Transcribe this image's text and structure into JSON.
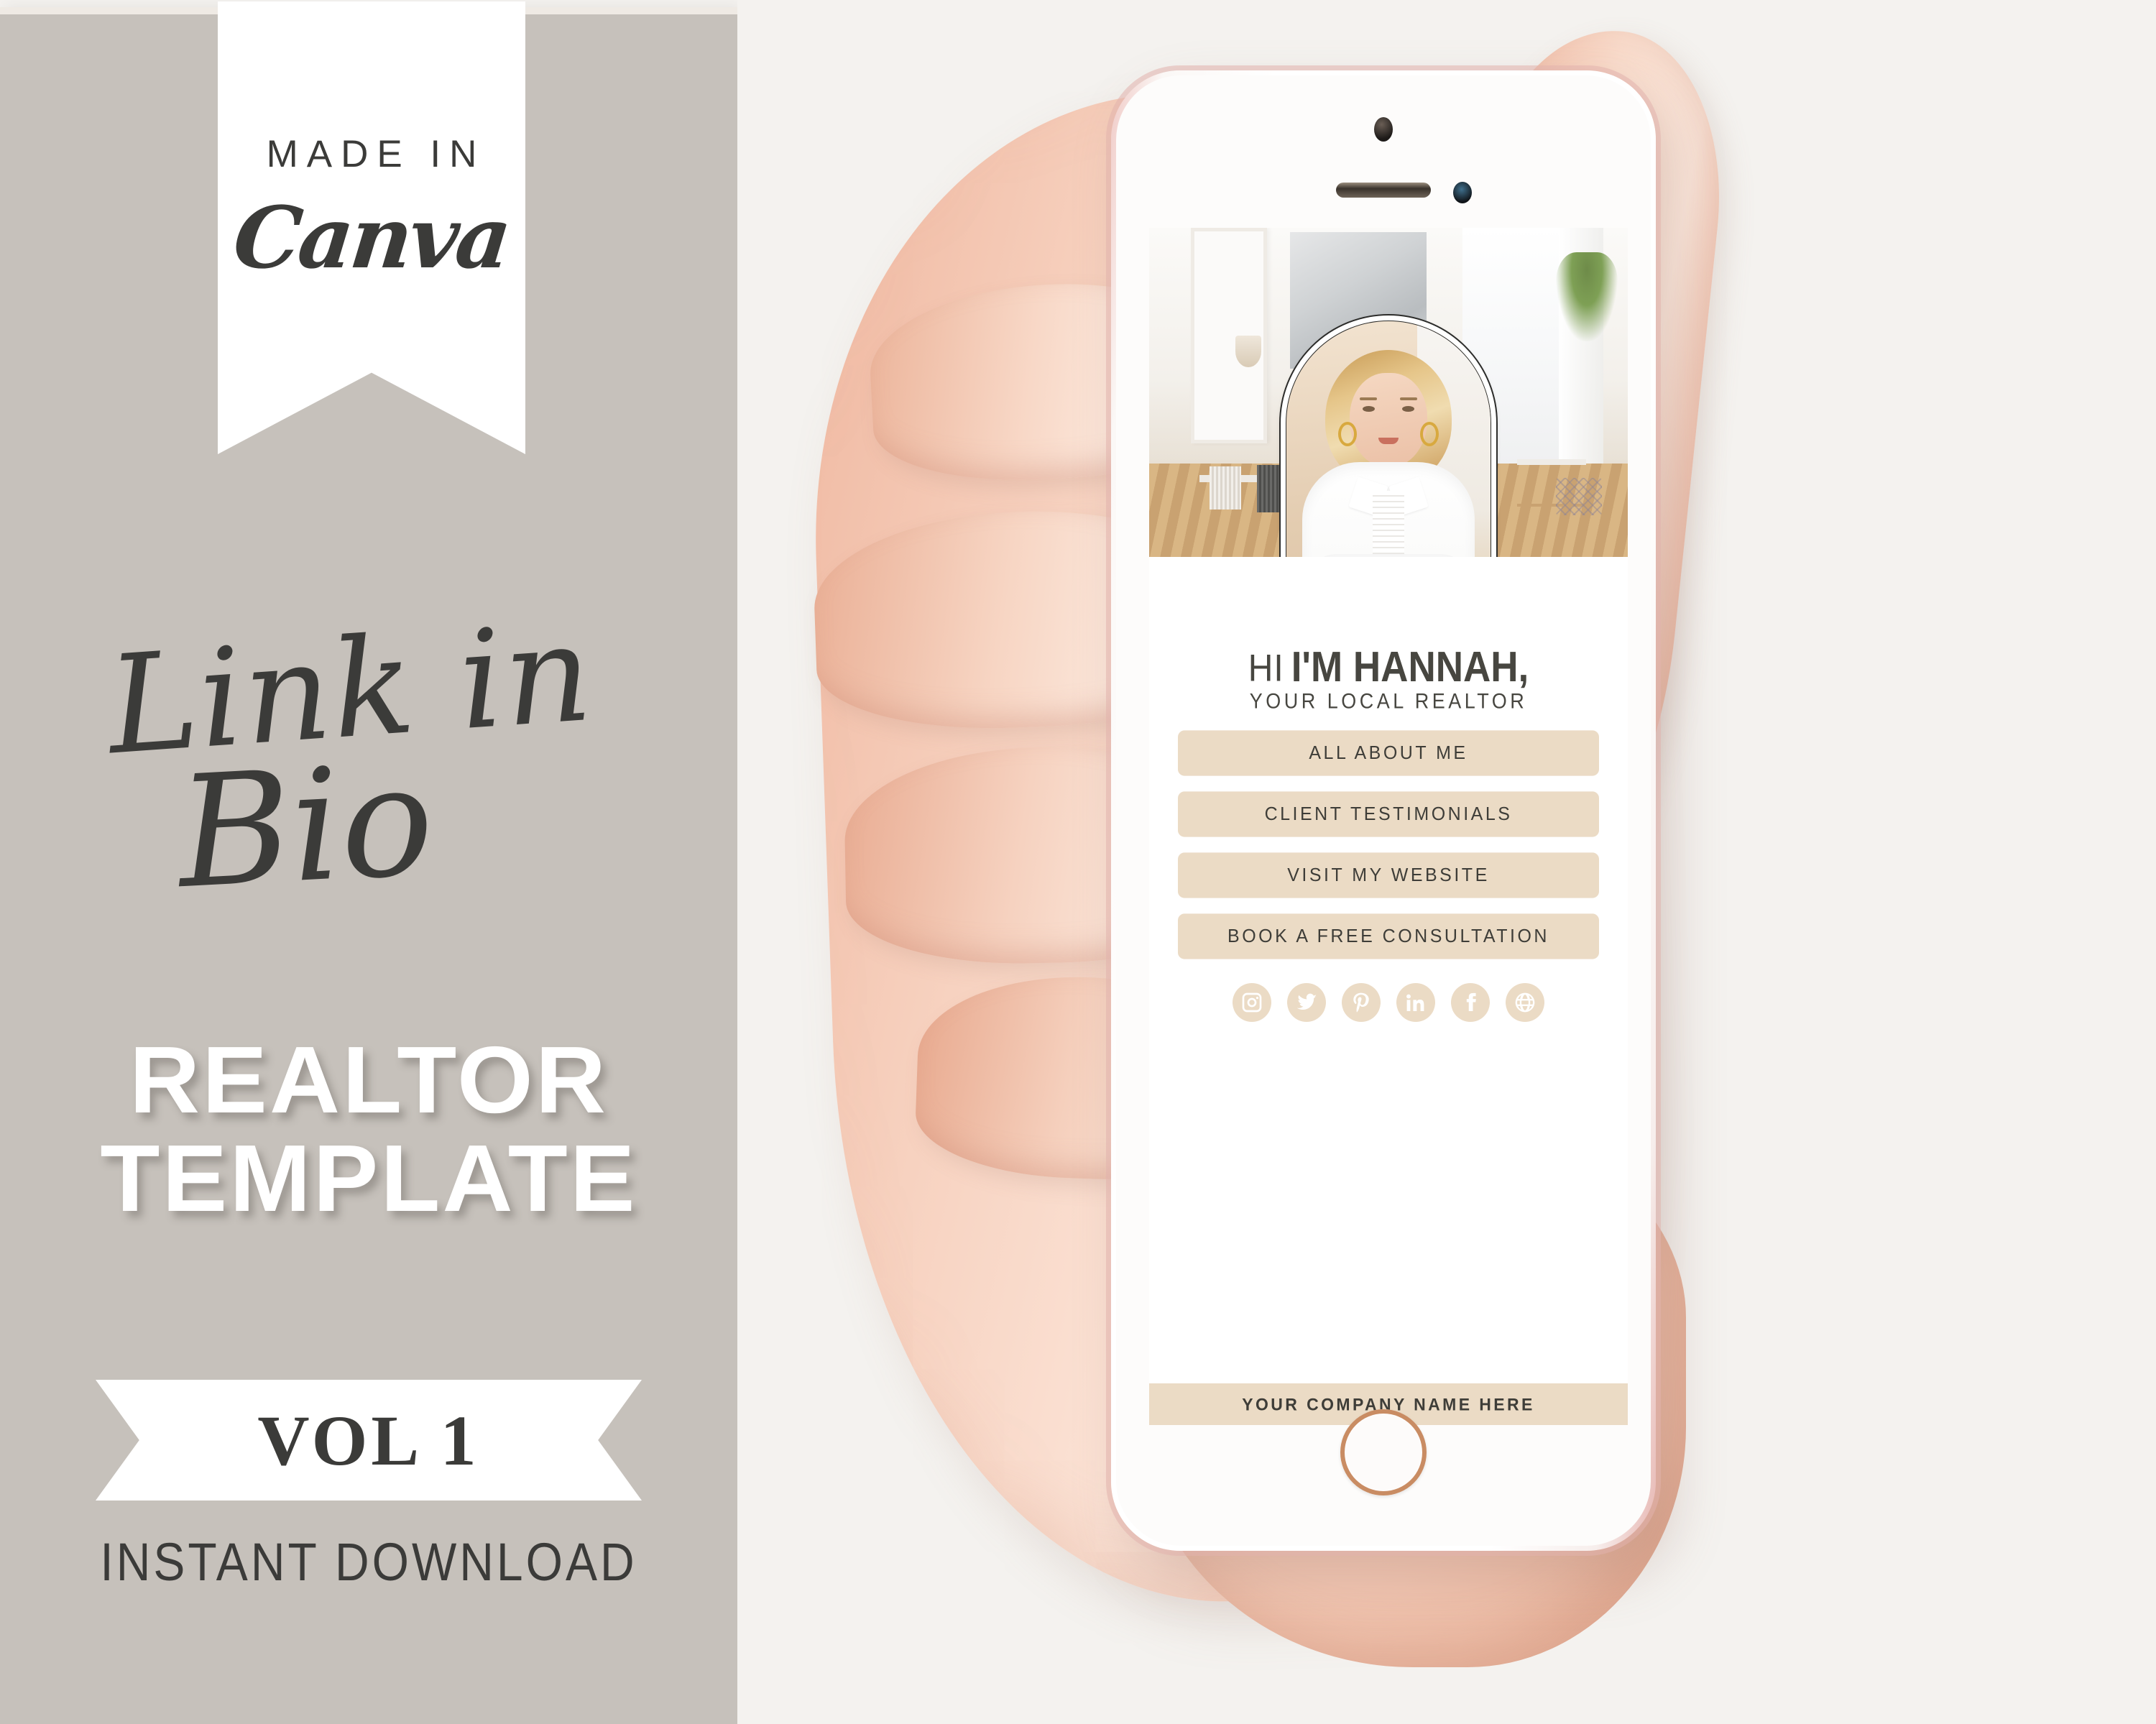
{
  "colors": {
    "left_panel_bg": "#C6C1BB",
    "page_bg": "#F4F2EF",
    "accent_beige": "#EBDBC5",
    "dark_text": "#3B3B39",
    "banner_white": "#FFFFFF",
    "phone_edge_rose": "#E2B2AD"
  },
  "left_panel": {
    "canva_badge": {
      "line1": "MADE IN",
      "line2": "Canva"
    },
    "script_title": {
      "line1": "Link in",
      "line2": "Bio"
    },
    "headline": {
      "line1": "REALTOR",
      "line2": "TEMPLATE"
    },
    "volume_ribbon": "VOL 1",
    "instant_download": "INSTANT DOWNLOAD"
  },
  "phone": {
    "screen": {
      "hero_image_alt": "bright-interior-dining-room-photo",
      "portrait_alt": "realtor-headshot-blonde-woman-white-blouse",
      "greeting_light": "HI",
      "greeting_bold": "I'M HANNAH,",
      "subtitle": "YOUR LOCAL REALTOR",
      "buttons": [
        {
          "label": "ALL ABOUT ME"
        },
        {
          "label": "CLIENT TESTIMONIALS"
        },
        {
          "label": "VISIT MY WEBSITE"
        },
        {
          "label": "BOOK A FREE CONSULTATION"
        }
      ],
      "social_icons": [
        {
          "name": "instagram-icon"
        },
        {
          "name": "twitter-icon"
        },
        {
          "name": "pinterest-icon"
        },
        {
          "name": "linkedin-icon"
        },
        {
          "name": "facebook-icon"
        },
        {
          "name": "globe-website-icon"
        }
      ],
      "company_name": "YOUR COMPANY NAME HERE"
    },
    "hardware": {
      "front_camera": "front-camera",
      "earpiece_speaker": "earpiece-speaker",
      "proximity_sensor": "proximity-sensor",
      "home_button": "home-button"
    }
  }
}
